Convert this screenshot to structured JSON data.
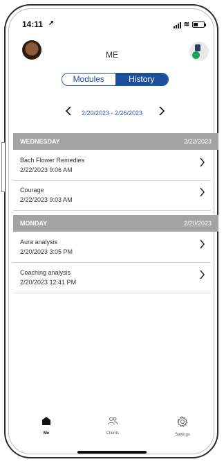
{
  "status": {
    "time": "14:11"
  },
  "header": {
    "title": "ME"
  },
  "segment": {
    "modules": "Modules",
    "history": "History"
  },
  "date_nav": {
    "range": "2/20/2023 - 2/26/2023",
    "prev": "<",
    "next": ">"
  },
  "sections": [
    {
      "day": "WEDNESDAY",
      "date": "2/22/2023",
      "items": [
        {
          "name": "Bach Flower Remedies",
          "date": "2/22/2023 9:06 AM"
        },
        {
          "name": "Courage",
          "date": "2/22/2023 9:03 AM"
        }
      ]
    },
    {
      "day": "MONDAY",
      "date": "2/20/2023",
      "items": [
        {
          "name": "Aura analysis",
          "date": "2/20/2023 3:05 PM"
        },
        {
          "name": "Coaching analysis",
          "date": "2/20/2023 12:41 PM"
        }
      ]
    }
  ],
  "tabs": [
    {
      "label": "Me",
      "icon": "home-icon"
    },
    {
      "label": "Clients",
      "icon": "clients-icon"
    },
    {
      "label": "Settings",
      "icon": "gear-icon"
    }
  ],
  "colors": {
    "accent": "#1c4f9c",
    "section_bg": "#a3a3a3",
    "date_text": "#2e5ea8"
  }
}
